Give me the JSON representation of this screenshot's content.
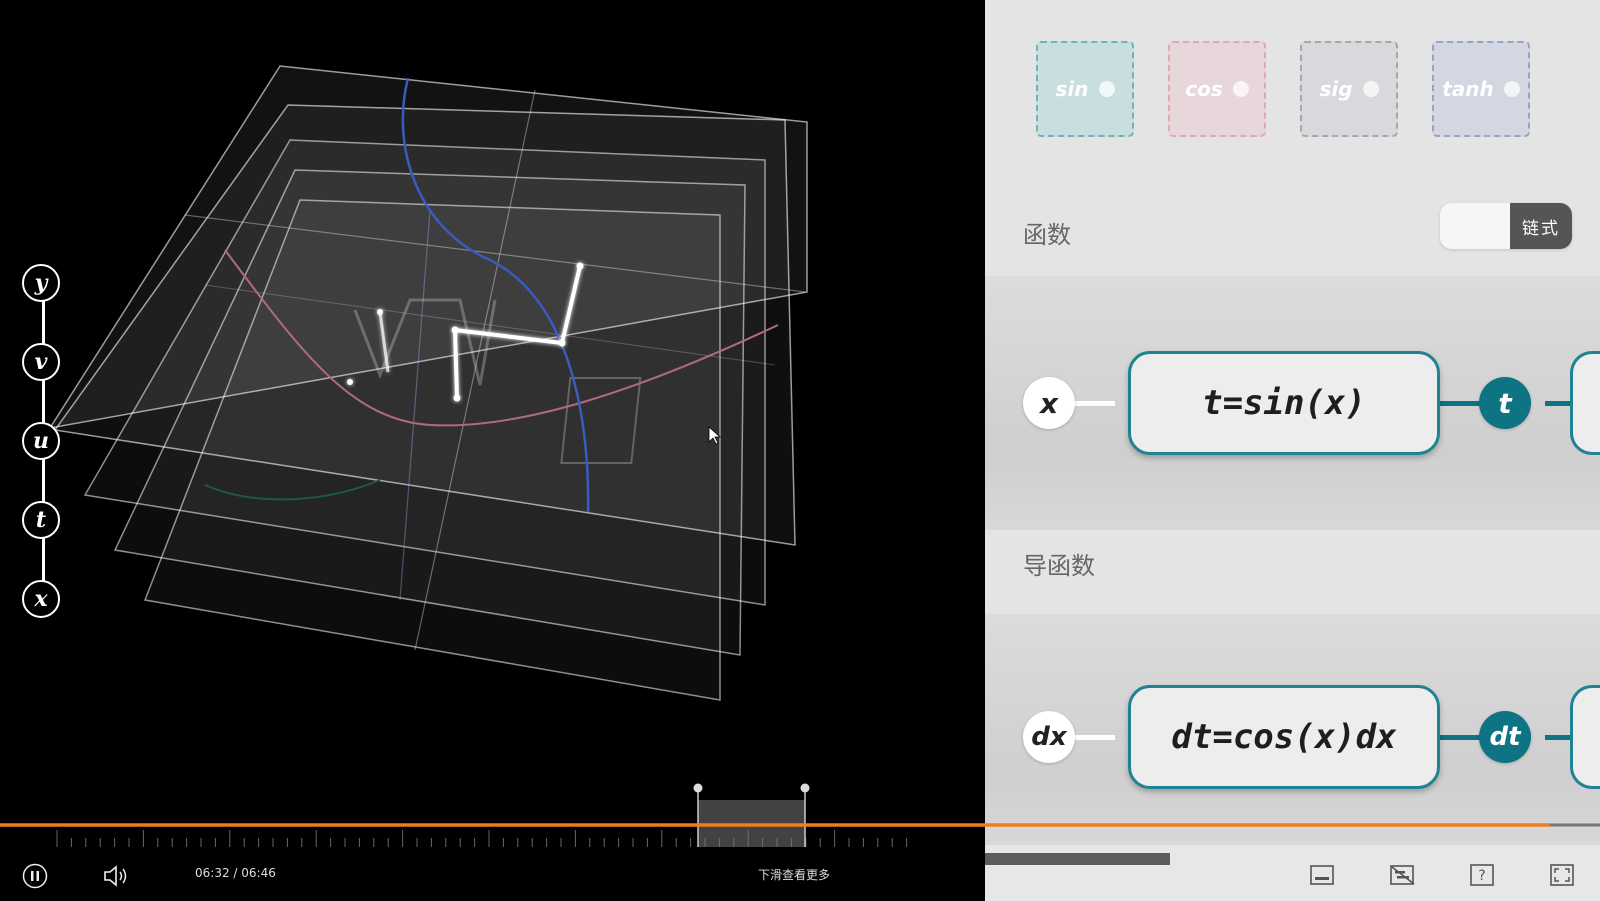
{
  "layers": [
    "y",
    "v",
    "u",
    "t",
    "x"
  ],
  "chips": [
    {
      "label": "sin",
      "border": "#6fb3b8",
      "fill": "#c9dedf"
    },
    {
      "label": "cos",
      "border": "#e0a8b4",
      "fill": "#e7d7da"
    },
    {
      "label": "sig",
      "border": "#a9a4b0",
      "fill": "#dad8dc"
    },
    {
      "label": "tanh",
      "border": "#9aa3c3",
      "fill": "#d4d7e1"
    }
  ],
  "function_section": {
    "label": "函数",
    "toggle_label": "链式",
    "input": "x",
    "formula": "t=sin(x)",
    "output": "t"
  },
  "derivative_section": {
    "label": "导函数",
    "input": "dx",
    "formula": "dt=cos(x)dx",
    "output": "dt"
  },
  "player": {
    "time": "06:32 / 06:46",
    "scroll_hint": "下滑查看更多",
    "progress": 0.969,
    "accent": "#f07f1b"
  },
  "icons": {
    "play": "pause-icon",
    "volume": "volume-icon",
    "cursor": "mouse-cursor-icon",
    "bottom_right": [
      "caption-icon",
      "no-danmaku-icon",
      "help-icon",
      "fullscreen-icon"
    ]
  }
}
